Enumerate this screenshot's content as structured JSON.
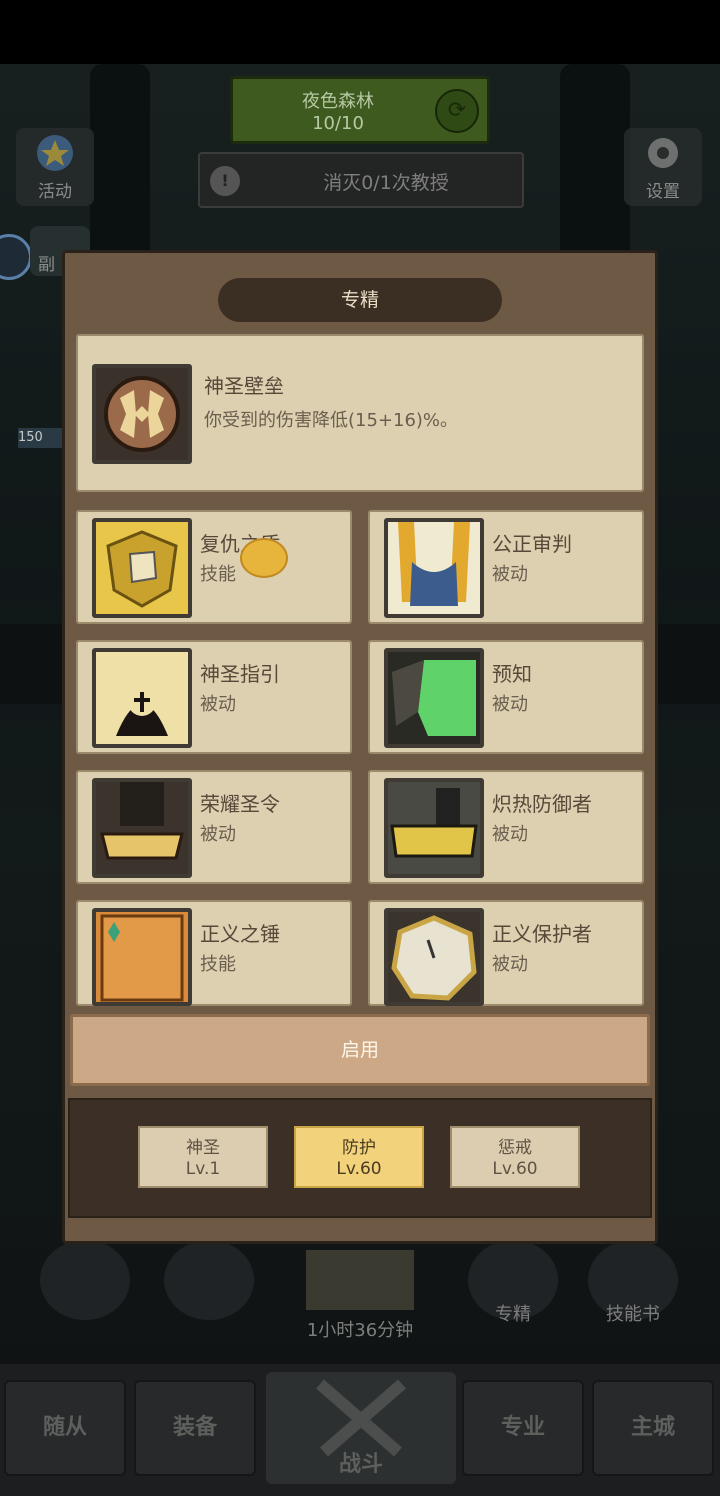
{
  "hud": {
    "zone_name": "夜色森林",
    "zone_progress": "10/10",
    "quest_text": "消灭0/1次教授",
    "activity_label": "活动",
    "settings_label": "设置",
    "dungeon_label": "副",
    "left_count": "150"
  },
  "modal": {
    "title": "专精",
    "selected": {
      "name": "神圣壁垒",
      "desc": "你受到的伤害降低(15+16)%。",
      "icon": "holy-shield-bulwark-icon"
    },
    "skills": [
      {
        "name": "复仇之盾",
        "type": "技能",
        "icon": "avenger-shield-icon"
      },
      {
        "name": "公正审判",
        "type": "被动",
        "icon": "judgement-helmet-icon"
      },
      {
        "name": "神圣指引",
        "type": "被动",
        "icon": "holy-guidance-icon"
      },
      {
        "name": "预知",
        "type": "被动",
        "icon": "foresight-mask-icon"
      },
      {
        "name": "荣耀圣令",
        "type": "被动",
        "icon": "glory-crown-icon"
      },
      {
        "name": "炽热防御者",
        "type": "被动",
        "icon": "ardent-defender-icon"
      },
      {
        "name": "正义之锤",
        "type": "技能",
        "icon": "hammer-of-justice-icon"
      },
      {
        "name": "正义保护者",
        "type": "被动",
        "icon": "righteous-protector-icon"
      }
    ],
    "apply_label": "启用",
    "specs": [
      {
        "name": "神圣",
        "level": "Lv.1",
        "active": false
      },
      {
        "name": "防护",
        "level": "Lv.60",
        "active": true
      },
      {
        "name": "惩戒",
        "level": "Lv.60",
        "active": false
      }
    ]
  },
  "bottom": {
    "timer": "1小时36分钟",
    "spec_label": "专精",
    "skillbook_label": "技能书",
    "nav": [
      "随从",
      "装备",
      "战斗",
      "专业",
      "主城"
    ]
  }
}
